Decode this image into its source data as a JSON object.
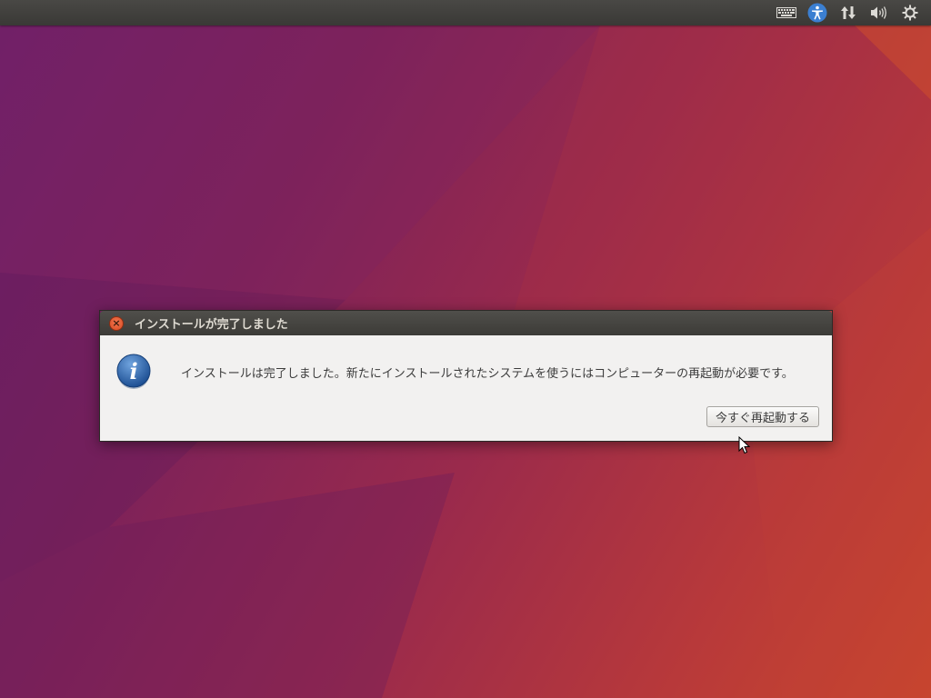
{
  "panel": {
    "indicators": [
      {
        "icon": "keyboard-icon"
      },
      {
        "icon": "accessibility-icon",
        "accent": "#3b7fd1"
      },
      {
        "icon": "network-icon"
      },
      {
        "icon": "volume-icon"
      },
      {
        "icon": "power-gear-icon"
      }
    ]
  },
  "dialog": {
    "title": "インストールが完了しました",
    "close_icon": "×",
    "message": "インストールは完了しました。新たにインストールされたシステムを使うにはコンピューターの再起動が必要です。",
    "restart_button": "今すぐ再起動する",
    "info_glyph": "i"
  },
  "colors": {
    "wallpaper_start": "#6d1f6a",
    "wallpaper_end": "#c9472c",
    "close_button": "#e05a2e",
    "dialog_body": "#f2f1f0"
  }
}
